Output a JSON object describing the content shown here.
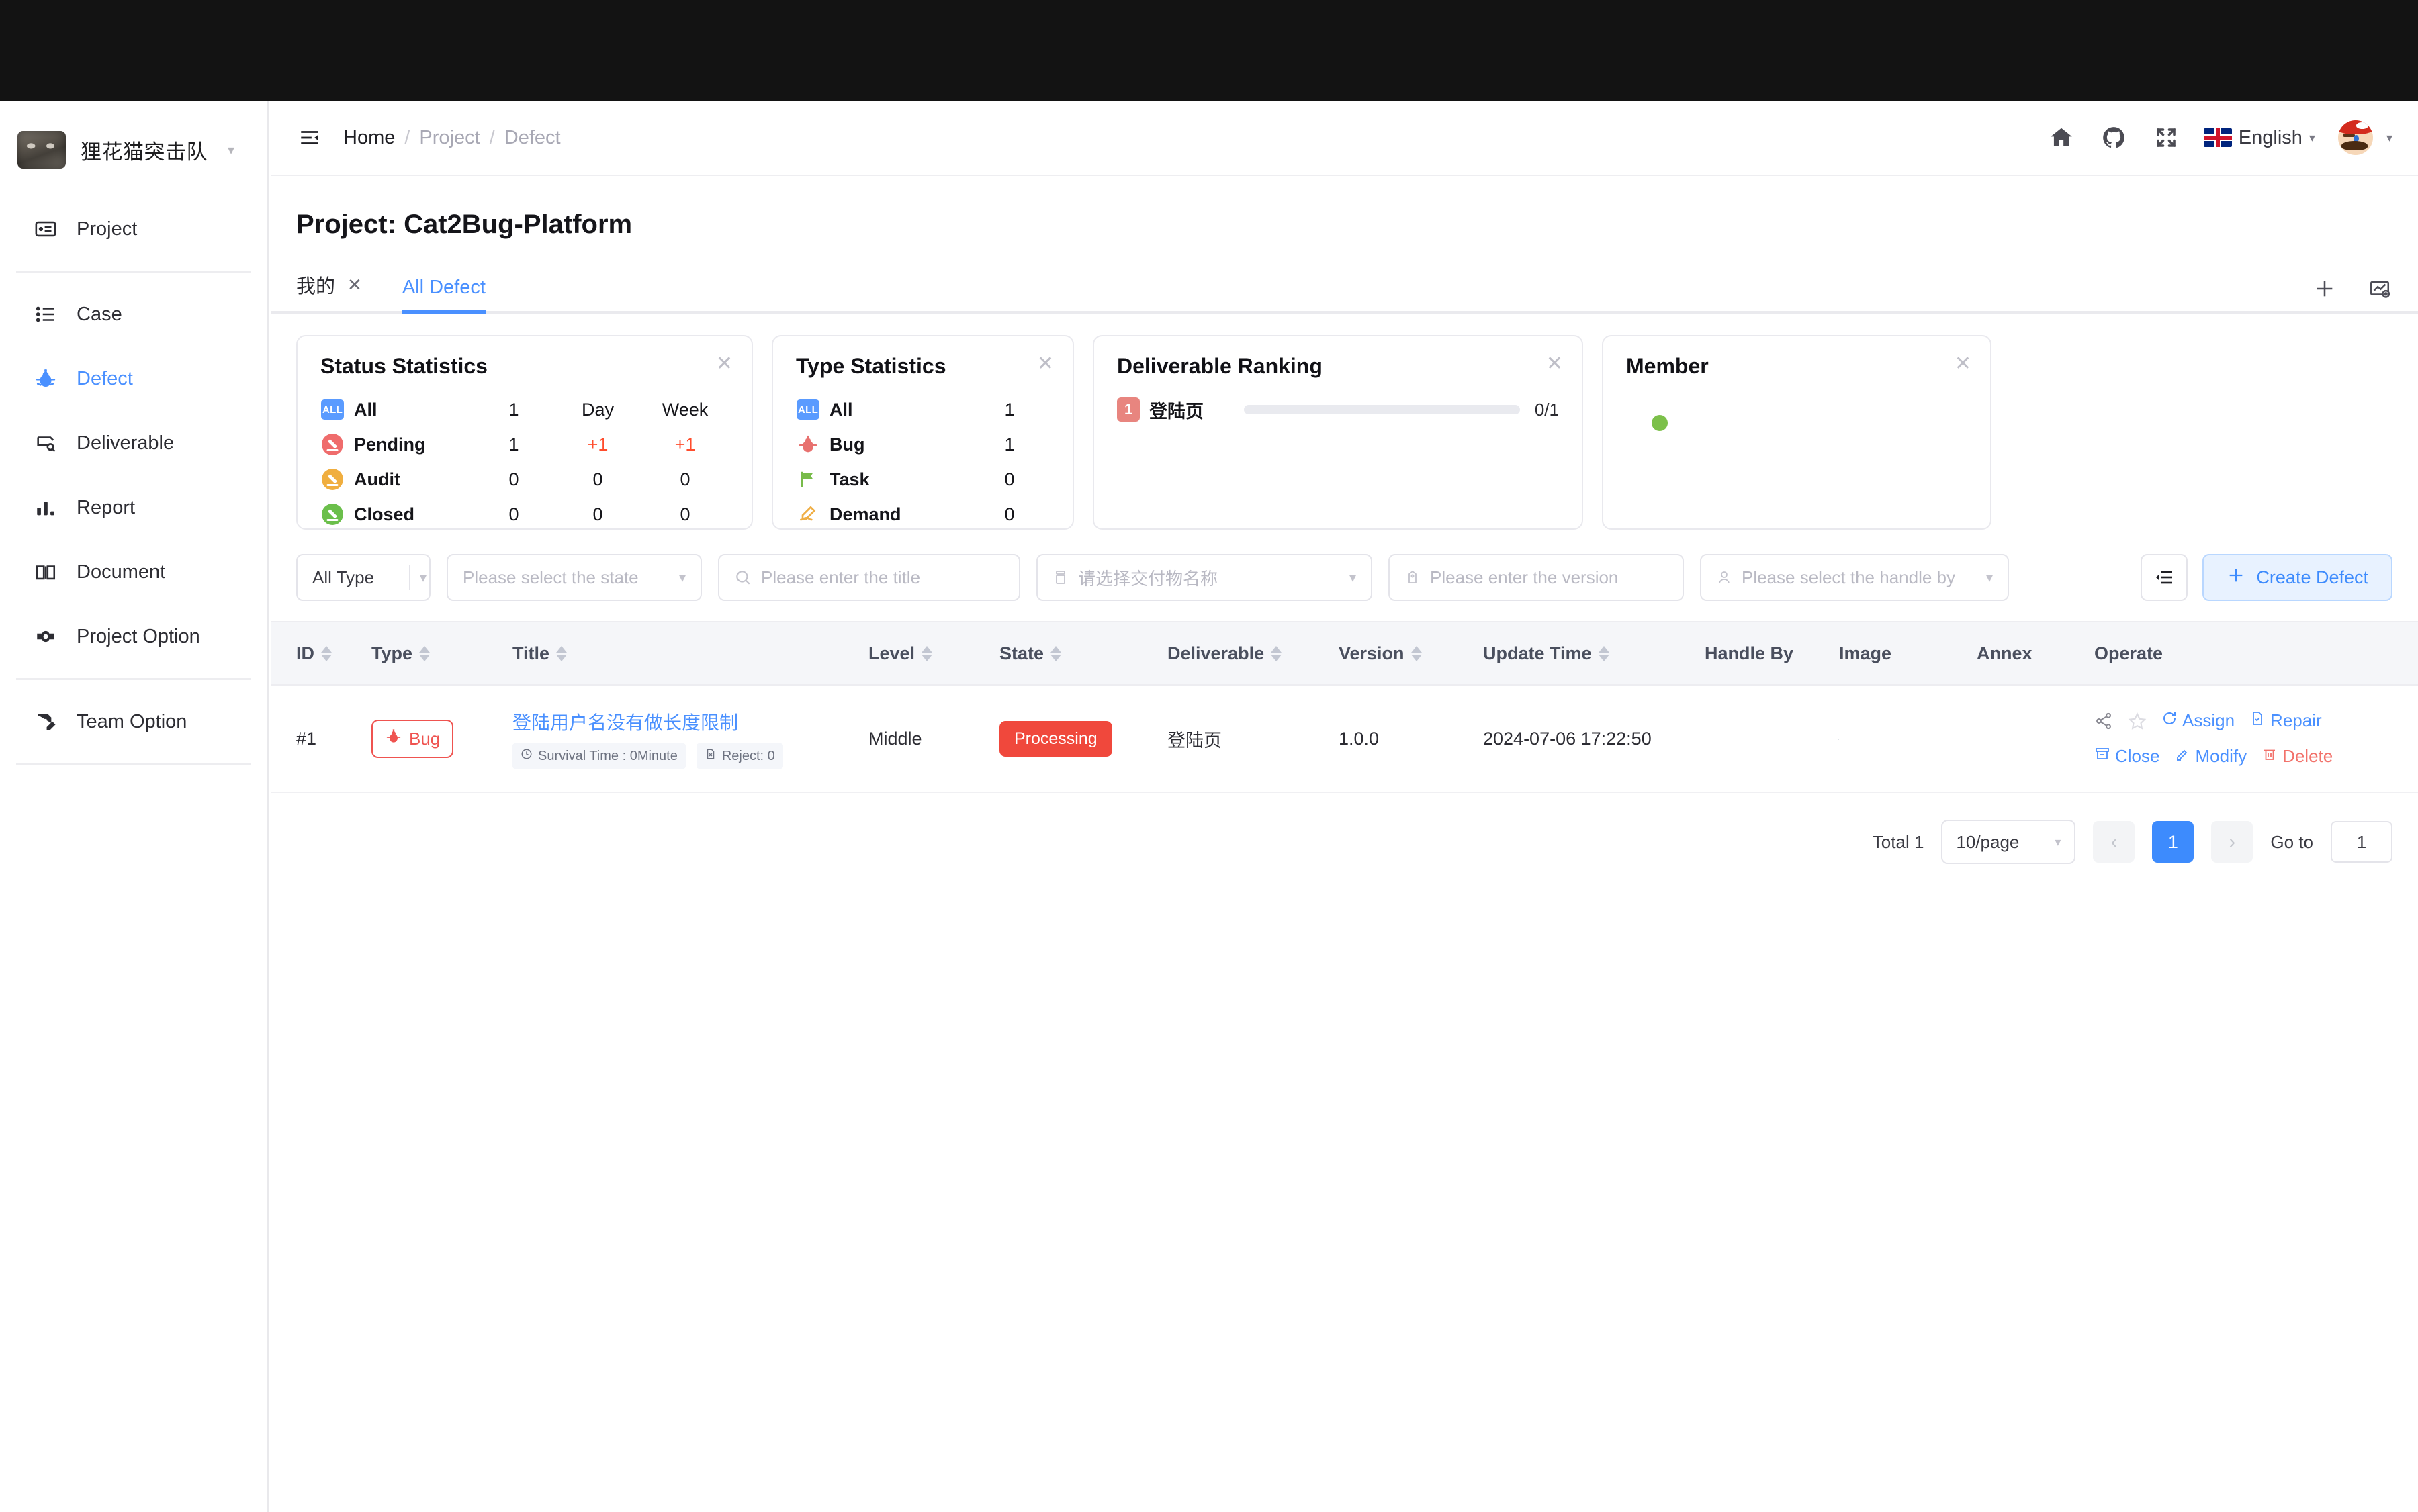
{
  "colors": {
    "accent": "#4a90ff",
    "danger": "#f0483c",
    "muted": "#b9b9c3"
  },
  "sidebar": {
    "brand": {
      "name": "狸花猫突击队",
      "avatar_icon": "cat-avatar",
      "caret_icon": "chevron-down-icon"
    },
    "items": [
      {
        "label": "Project",
        "icon": "project-icon",
        "active": false
      },
      {
        "label": "Case",
        "icon": "case-list-icon",
        "active": false
      },
      {
        "label": "Defect",
        "icon": "bug-icon",
        "active": true
      },
      {
        "label": "Deliverable",
        "icon": "deliverable-icon",
        "active": false
      },
      {
        "label": "Report",
        "icon": "bar-chart-icon",
        "active": false
      },
      {
        "label": "Document",
        "icon": "book-icon",
        "active": false
      },
      {
        "label": "Project Option",
        "icon": "gear-icon",
        "active": false
      },
      {
        "label": "Team Option",
        "icon": "team-option-icon",
        "active": false
      }
    ]
  },
  "header": {
    "collapse_icon": "menu-fold-icon",
    "breadcrumb": {
      "home": "Home",
      "sep1": "/",
      "project": "Project",
      "sep2": "/",
      "current": "Defect"
    },
    "icons": [
      "home-icon",
      "github-icon",
      "fullscreen-icon"
    ],
    "language": {
      "label": "English",
      "flag_icon": "uk-flag-icon",
      "caret_icon": "caret-down-icon"
    },
    "avatar": {
      "icon": "mario-avatar",
      "caret_icon": "caret-down-icon"
    }
  },
  "page": {
    "title_label": "Project:",
    "title_value": "Cat2Bug-Platform"
  },
  "tabs": {
    "items": [
      {
        "label": "我的",
        "active": false,
        "closable": true,
        "close_icon": "close-icon"
      },
      {
        "label": "All Defect",
        "active": true,
        "closable": false
      }
    ],
    "actions": [
      {
        "icon": "plus-icon",
        "name": "add-tab-button"
      },
      {
        "icon": "chart-preview-icon",
        "name": "chart-preview-button"
      }
    ]
  },
  "cards": {
    "status": {
      "title": "Status Statistics",
      "close_icon": "close-icon",
      "col_headers": {
        "count": "1",
        "day": "Day",
        "week": "Week"
      },
      "rows": [
        {
          "label": "All",
          "icon": "all-badge",
          "count": "1",
          "day": "Day",
          "week": "Week",
          "header_row": true
        },
        {
          "label": "Pending",
          "icon": "pending-dot",
          "count": "1",
          "day": "+1",
          "week": "+1",
          "highlight": true
        },
        {
          "label": "Audit",
          "icon": "audit-dot",
          "count": "0",
          "day": "0",
          "week": "0",
          "highlight": false
        },
        {
          "label": "Closed",
          "icon": "closed-dot",
          "count": "0",
          "day": "0",
          "week": "0",
          "highlight": false
        }
      ]
    },
    "type": {
      "title": "Type Statistics",
      "close_icon": "close-icon",
      "rows": [
        {
          "label": "All",
          "icon": "all-badge",
          "count": "1"
        },
        {
          "label": "Bug",
          "icon": "bug-icon",
          "count": "1"
        },
        {
          "label": "Task",
          "icon": "flag-icon",
          "count": "0"
        },
        {
          "label": "Demand",
          "icon": "demand-pen-icon",
          "count": "0"
        }
      ]
    },
    "deliverable": {
      "title": "Deliverable Ranking",
      "close_icon": "close-icon",
      "rows": [
        {
          "rank": "1",
          "name": "登陆页",
          "value": "0/1",
          "progress": 0
        }
      ]
    },
    "member": {
      "title": "Member",
      "close_icon": "close-icon",
      "members": [
        {
          "avatar_icon": "mario-avatar",
          "status": "online"
        }
      ]
    }
  },
  "filters": {
    "type_value": "All Type",
    "state_placeholder": "Please select the state",
    "title_placeholder": "Please enter the title",
    "deliverable_placeholder": "请选择交付物名称",
    "version_placeholder": "Please enter the version",
    "handle_placeholder": "Please select the handle by",
    "settings_icon": "column-settings-icon",
    "create_label": "Create Defect",
    "create_icon": "plus-icon"
  },
  "table": {
    "columns": [
      {
        "label": "ID",
        "sortable": true
      },
      {
        "label": "Type",
        "sortable": true
      },
      {
        "label": "Title",
        "sortable": true
      },
      {
        "label": "Level",
        "sortable": true
      },
      {
        "label": "State",
        "sortable": true
      },
      {
        "label": "Deliverable",
        "sortable": true
      },
      {
        "label": "Version",
        "sortable": true
      },
      {
        "label": "Update Time",
        "sortable": true
      },
      {
        "label": "Handle By",
        "sortable": false
      },
      {
        "label": "Image",
        "sortable": false
      },
      {
        "label": "Annex",
        "sortable": false
      },
      {
        "label": "Operate",
        "sortable": false
      }
    ],
    "rows": [
      {
        "id": "#1",
        "type": "Bug",
        "type_icon": "bug-icon",
        "title": "登陆用户名没有做长度限制",
        "tag_survival": "Survival Time : 0Minute",
        "tag_survival_icon": "clock-icon",
        "tag_reject": "Reject: 0",
        "tag_reject_icon": "file-icon",
        "level": "Middle",
        "state": "Processing",
        "deliverable": "登陆页",
        "version": "1.0.0",
        "update_time": "2024-07-06 17:22:50",
        "handle_by_icon": "mario-avatar",
        "image_icon": "screenshot-thumbnail",
        "annex": "",
        "operate": {
          "share_icon": "share-icon",
          "star_icon": "star-icon",
          "assign": "Assign",
          "assign_icon": "refresh-icon",
          "repair": "Repair",
          "repair_icon": "file-check-icon",
          "close": "Close",
          "close_icon": "archive-icon",
          "modify": "Modify",
          "modify_icon": "edit-icon",
          "delete": "Delete",
          "delete_icon": "trash-icon"
        }
      }
    ]
  },
  "pagination": {
    "total": "Total 1",
    "page_size": "10/page",
    "prev_icon": "chevron-left-icon",
    "next_icon": "chevron-right-icon",
    "current_page": "1",
    "goto_label": "Go to",
    "goto_value": "1"
  }
}
